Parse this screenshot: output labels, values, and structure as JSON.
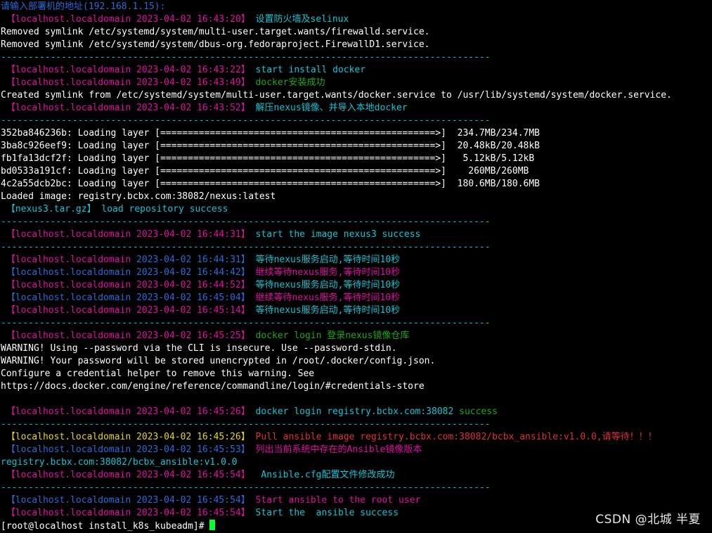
{
  "colors": {
    "w": "#ffffff",
    "m": "#e0109f",
    "c": "#17c3d3",
    "g": "#21a81a",
    "y": "#e6d619",
    "b": "#2a6bd8",
    "r": "#e0303a",
    "bl": "#2a6bd8",
    "cursor": "#00ff33"
  },
  "terminal": {
    "lines": [
      [
        [
          "b",
          "请输入部署机的地址(192.168.1.15):"
        ]
      ],
      [
        [
          "m",
          " 【localhost.localdomain 2023-04-02 16:43:20】 "
        ],
        [
          "c",
          "设置防火墙及selinux"
        ]
      ],
      [
        [
          "w",
          "Removed symlink /etc/systemd/system/multi-user.target.wants/firewalld.service."
        ]
      ],
      [
        [
          "w",
          "Removed symlink /etc/systemd/system/dbus-org.fedoraproject.FirewallD1.service."
        ]
      ],
      [
        [
          "c",
          "-----------------------------------------------------------------------------------------"
        ]
      ],
      [
        [
          "m",
          " 【localhost.localdomain 2023-04-02 16:43:22】 "
        ],
        [
          "c",
          "start install docker"
        ]
      ],
      [
        [
          "m",
          " 【localhost.localdomain 2023-04-02 16:43:49】 "
        ],
        [
          "g",
          "docker安装成功"
        ]
      ],
      [
        [
          "w",
          "Created symlink from /etc/systemd/system/multi-user.target.wants/docker.service to /usr/lib/systemd/system/docker.service."
        ]
      ],
      [
        [
          "m",
          " 【localhost.localdomain 2023-04-02 16:43:52】 "
        ],
        [
          "c",
          "解压nexus镜像、并导入本地docker"
        ]
      ],
      [
        [
          "c",
          "-----------------------------------------------------------------------------------------"
        ]
      ],
      [
        [
          "w",
          "352ba846236b: Loading layer [==================================================>]  234.7MB/234.7MB"
        ]
      ],
      [
        [
          "w",
          "3ba8c926eef9: Loading layer [==================================================>]  20.48kB/20.48kB"
        ]
      ],
      [
        [
          "w",
          "fb1fa13dcf2f: Loading layer [==================================================>]   5.12kB/5.12kB"
        ]
      ],
      [
        [
          "w",
          "bd0533a191cf: Loading layer [==================================================>]    260MB/260MB"
        ]
      ],
      [
        [
          "w",
          "4c2a55dcb2bc: Loading layer [==================================================>]  180.6MB/180.6MB"
        ]
      ],
      [
        [
          "w",
          "Loaded image: registry.bcbx.com:38082/nexus:latest"
        ]
      ],
      [
        [
          "c",
          " 【nexus3.tar.gz】 load repository success"
        ]
      ],
      [
        [
          "c",
          "-----------------------------------------------------------------------------------------"
        ]
      ],
      [
        [
          "m",
          " 【localhost.localdomain 2023-04-02 16:44:31】 "
        ],
        [
          "c",
          "start the image nexus3 success"
        ]
      ],
      [
        [
          "c",
          "-----------------------------------------------------------------------------------------"
        ]
      ],
      [
        [
          "m",
          " 【localhost.localdomain "
        ],
        [
          "b",
          "2023-04-02 16:44:31】 "
        ],
        [
          "c",
          "等待nexus服务启动,等待时间10秒"
        ]
      ],
      [
        [
          "b",
          " 【localhost.localdomain 2023-04-02 16:44:42】 "
        ],
        [
          "m",
          "继续等待nexus服务,等待时间10秒"
        ]
      ],
      [
        [
          "m",
          " 【localhost.localdomain 2023-04-02 16:44:52】 "
        ],
        [
          "c",
          "等待nexus服务启动,等待时间10秒"
        ]
      ],
      [
        [
          "b",
          " 【localhost.localdomain 2023-04-02 16:45:04】 "
        ],
        [
          "m",
          "继续等待nexus服务,等待时间10秒"
        ]
      ],
      [
        [
          "m",
          " 【localhost.localdomain 2023-04-02 16:45:14】 "
        ],
        [
          "c",
          "等待nexus服务启动,等待时间10秒"
        ]
      ],
      [
        [
          "c",
          "-----------------------------------------------------------------------------------------"
        ]
      ],
      [
        [
          "m",
          " 【localhost.localdomain 2023-04-02 16:45:25】 "
        ],
        [
          "g",
          "docker login 登录nexus镜像仓库"
        ]
      ],
      [
        [
          "w",
          "WARNING! Using --password via the CLI is insecure. Use --password-stdin."
        ]
      ],
      [
        [
          "w",
          "WARNING! Your password will be stored unencrypted in /root/.docker/config.json."
        ]
      ],
      [
        [
          "w",
          "Configure a credential helper to remove this warning. See"
        ]
      ],
      [
        [
          "w",
          "https://docs.docker.com/engine/reference/commandline/login/#credentials-store"
        ]
      ],
      [
        [
          "w",
          " "
        ]
      ],
      [
        [
          "m",
          " 【localhost.localdomain 2023-04-02 16:45:26】 "
        ],
        [
          "c",
          "docker login registry.bcbx.com:38082 "
        ],
        [
          "g",
          "success"
        ]
      ],
      [
        [
          "c",
          "-----------------------------------------------------------------------------------------"
        ]
      ],
      [
        [
          "y",
          " 【localhost.localdomain 2023-04-02 16:45:26】 "
        ],
        [
          "r",
          "Pull ansible image registry.bcbx.com:38082/bcbx_ansible:v1.0.0,请等待！！！"
        ]
      ],
      [
        [
          "b",
          " 【localhost.localdomain 2023-04-02 16:45:53】 "
        ],
        [
          "m",
          "列出当前系统中存在的Ansible镜像版本"
        ]
      ],
      [
        [
          "c",
          "registry.bcbx.com:38082/bcbx_ansible:v1.0.0"
        ]
      ],
      [
        [
          "m",
          " 【localhost.localdomain 2023-04-02 16:45:54】 "
        ],
        [
          "c",
          " Ansible.cfg配置文件修改成功"
        ]
      ],
      [
        [
          "c",
          "-----------------------------------------------------------------------------------------"
        ]
      ],
      [
        [
          "b",
          " 【localhost.localdomain 2023-04-02 16:45:54】 "
        ],
        [
          "m",
          "Start ansible to the root user"
        ]
      ],
      [
        [
          "m",
          " 【localhost.localdomain 2023-04-02 16:45:54】 "
        ],
        [
          "c",
          "Start the  ansible success"
        ]
      ]
    ],
    "prompt": "[root@localhost install_k8s_kubeadm]# "
  },
  "watermark": "CSDN @北城 半夏"
}
